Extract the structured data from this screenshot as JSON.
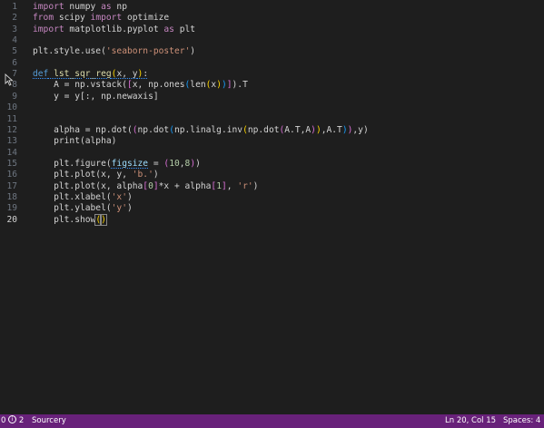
{
  "editor": {
    "active_line": 20,
    "lines": [
      {
        "n": "1",
        "tokens": [
          {
            "t": "import",
            "c": "kw"
          },
          {
            "t": " numpy ",
            "c": "text"
          },
          {
            "t": "as",
            "c": "kw"
          },
          {
            "t": " np",
            "c": "text"
          }
        ]
      },
      {
        "n": "2",
        "tokens": [
          {
            "t": "from",
            "c": "kw"
          },
          {
            "t": " scipy ",
            "c": "text"
          },
          {
            "t": "import",
            "c": "kw"
          },
          {
            "t": " optimize",
            "c": "text"
          }
        ]
      },
      {
        "n": "3",
        "tokens": [
          {
            "t": "import",
            "c": "kw"
          },
          {
            "t": " matplotlib.pyplot ",
            "c": "text"
          },
          {
            "t": "as",
            "c": "kw"
          },
          {
            "t": " plt",
            "c": "text"
          }
        ]
      },
      {
        "n": "4",
        "tokens": []
      },
      {
        "n": "5",
        "tokens": [
          {
            "t": "plt.style.use(",
            "c": "text"
          },
          {
            "t": "'seaborn-poster'",
            "c": "str"
          },
          {
            "t": ")",
            "c": "text"
          }
        ]
      },
      {
        "n": "6",
        "tokens": []
      },
      {
        "n": "7",
        "tokens": [
          {
            "t": "def",
            "c": "def",
            "sq": true
          },
          {
            "t": " ",
            "c": "text",
            "sq": true
          },
          {
            "t": "lst_sqr_reg",
            "c": "fn",
            "sq": true
          },
          {
            "t": "(",
            "c": "br1",
            "sq": true
          },
          {
            "t": "x, y",
            "c": "text",
            "sq": true
          },
          {
            "t": ")",
            "c": "br1",
            "sq": true
          },
          {
            "t": ":",
            "c": "text",
            "sq": true
          }
        ]
      },
      {
        "n": "8",
        "tokens": [
          {
            "t": "    A = np.vstack(",
            "c": "text"
          },
          {
            "t": "[",
            "c": "br2"
          },
          {
            "t": "x, np.ones",
            "c": "text"
          },
          {
            "t": "(",
            "c": "br3"
          },
          {
            "t": "len",
            "c": "text"
          },
          {
            "t": "(",
            "c": "br1"
          },
          {
            "t": "x",
            "c": "text"
          },
          {
            "t": ")",
            "c": "br1"
          },
          {
            "t": ")",
            "c": "br3"
          },
          {
            "t": "]",
            "c": "br2"
          },
          {
            "t": ").T",
            "c": "text"
          }
        ]
      },
      {
        "n": "9",
        "tokens": [
          {
            "t": "    y = y[:, np.newaxis]",
            "c": "text"
          }
        ]
      },
      {
        "n": "10",
        "tokens": []
      },
      {
        "n": "11",
        "tokens": []
      },
      {
        "n": "12",
        "tokens": [
          {
            "t": "    alpha = np.dot(",
            "c": "text"
          },
          {
            "t": "(",
            "c": "br2"
          },
          {
            "t": "np.dot",
            "c": "text"
          },
          {
            "t": "(",
            "c": "br3"
          },
          {
            "t": "np.linalg.inv",
            "c": "text"
          },
          {
            "t": "(",
            "c": "br1"
          },
          {
            "t": "np.dot",
            "c": "text"
          },
          {
            "t": "(",
            "c": "br2"
          },
          {
            "t": "A.T,A",
            "c": "text"
          },
          {
            "t": ")",
            "c": "br2"
          },
          {
            "t": ")",
            "c": "br1"
          },
          {
            "t": ",A.T",
            "c": "text"
          },
          {
            "t": ")",
            "c": "br3"
          },
          {
            "t": ")",
            "c": "br2"
          },
          {
            "t": ",y)",
            "c": "text"
          }
        ]
      },
      {
        "n": "13",
        "tokens": [
          {
            "t": "    print(alpha)",
            "c": "text"
          }
        ]
      },
      {
        "n": "14",
        "tokens": []
      },
      {
        "n": "15",
        "tokens": [
          {
            "t": "    plt.figure(",
            "c": "text"
          },
          {
            "t": "figsize",
            "c": "var",
            "sq": true
          },
          {
            "t": " = ",
            "c": "text"
          },
          {
            "t": "(",
            "c": "br2"
          },
          {
            "t": "10",
            "c": "num"
          },
          {
            "t": ",",
            "c": "text"
          },
          {
            "t": "8",
            "c": "num"
          },
          {
            "t": ")",
            "c": "br2"
          },
          {
            "t": ")",
            "c": "text"
          }
        ]
      },
      {
        "n": "16",
        "tokens": [
          {
            "t": "    plt.plot(x, y, ",
            "c": "text"
          },
          {
            "t": "'b.'",
            "c": "str"
          },
          {
            "t": ")",
            "c": "text"
          }
        ]
      },
      {
        "n": "17",
        "tokens": [
          {
            "t": "    plt.plot(x, alpha",
            "c": "text"
          },
          {
            "t": "[",
            "c": "br2"
          },
          {
            "t": "0",
            "c": "num"
          },
          {
            "t": "]",
            "c": "br2"
          },
          {
            "t": "*x + alpha",
            "c": "text"
          },
          {
            "t": "[",
            "c": "br2"
          },
          {
            "t": "1",
            "c": "num"
          },
          {
            "t": "]",
            "c": "br2"
          },
          {
            "t": ", ",
            "c": "text"
          },
          {
            "t": "'r'",
            "c": "str"
          },
          {
            "t": ")",
            "c": "text"
          }
        ]
      },
      {
        "n": "18",
        "tokens": [
          {
            "t": "    plt.xlabel(",
            "c": "text"
          },
          {
            "t": "'x'",
            "c": "str"
          },
          {
            "t": ")",
            "c": "text"
          }
        ]
      },
      {
        "n": "19",
        "tokens": [
          {
            "t": "    plt.ylabel(",
            "c": "text"
          },
          {
            "t": "'y'",
            "c": "str"
          },
          {
            "t": ")",
            "c": "text"
          }
        ]
      },
      {
        "n": "20",
        "tokens": [
          {
            "t": "    plt.show",
            "c": "text"
          },
          {
            "t": "(",
            "c": "br1",
            "bm": true
          },
          {
            "t": ")",
            "c": "br1",
            "bm": true
          }
        ]
      }
    ]
  },
  "statusbar": {
    "errors": "0",
    "info_symbol": "i",
    "info_count": "2",
    "extension": "Sourcery",
    "cursor_position": "Ln 20, Col 15",
    "indentation": "Spaces: 4",
    "background": "#68217a"
  },
  "colors": {
    "editor_bg": "#1e1e1e",
    "keyword": "#c586c0",
    "def_keyword": "#569cd6",
    "function": "#dcdcaa",
    "string": "#ce9178",
    "number": "#b5cea8"
  }
}
